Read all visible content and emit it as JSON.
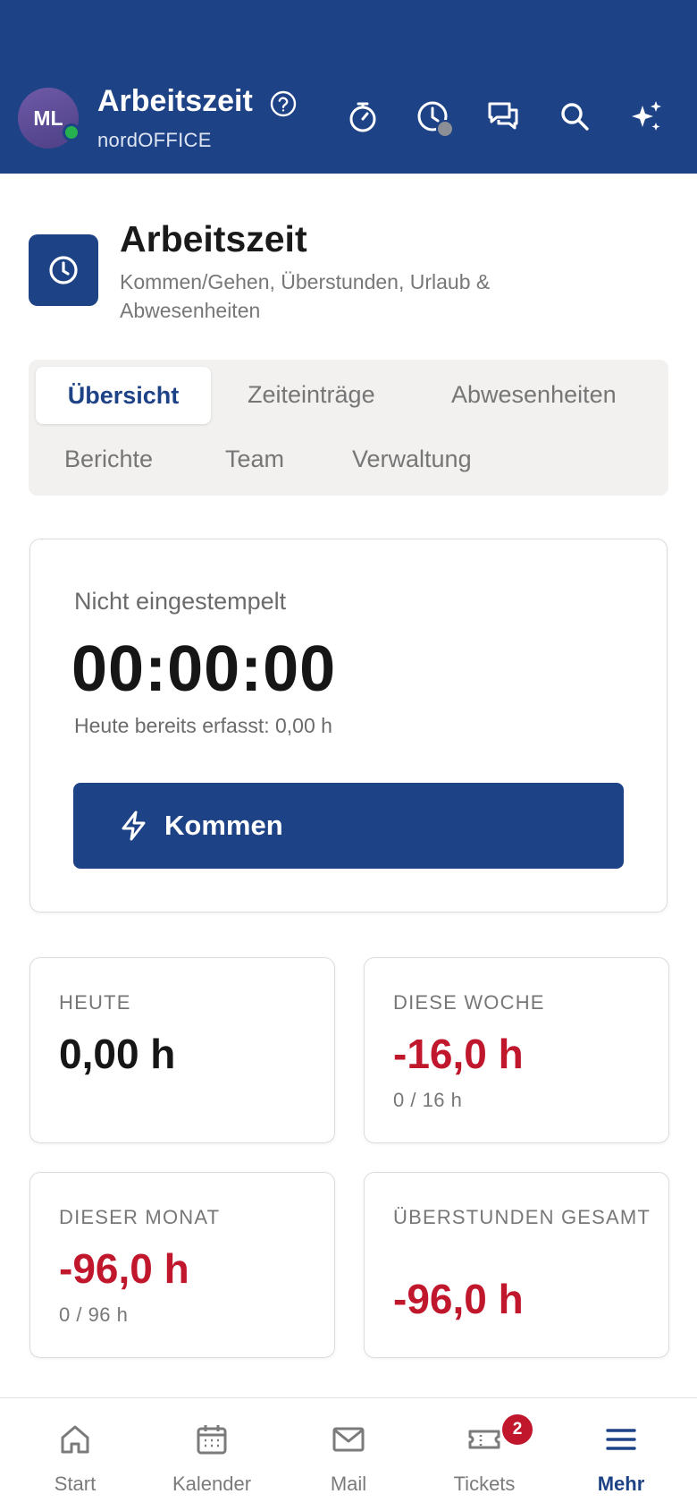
{
  "header": {
    "avatar_initials": "ML",
    "title": "Arbeitszeit",
    "subtitle": "nordOFFICE",
    "online_status_color": "#27b04f",
    "icons": [
      "help-icon",
      "stopwatch-icon",
      "clock-history-icon",
      "chat-icon",
      "search-icon",
      "sparkles-icon"
    ]
  },
  "module": {
    "icon": "clock-icon",
    "title": "Arbeitszeit",
    "description": "Kommen/Gehen, Überstunden, Urlaub & Abwesenheiten"
  },
  "tabs": [
    {
      "label": "Übersicht",
      "active": true
    },
    {
      "label": "Zeiteinträge",
      "active": false
    },
    {
      "label": "Abwesenheiten",
      "active": false
    },
    {
      "label": "Berichte",
      "active": false
    },
    {
      "label": "Team",
      "active": false
    },
    {
      "label": "Verwaltung",
      "active": false
    }
  ],
  "clock": {
    "status": "Nicht eingestempelt",
    "timer": "00:00:00",
    "today_recorded": "Heute bereits erfasst: 0,00 h",
    "button_label": "Kommen",
    "button_icon": "lightning-icon"
  },
  "stats": [
    {
      "label": "HEUTE",
      "value": "0,00 h",
      "sub": ""
    },
    {
      "label": "DIESE WOCHE",
      "value": "-16,0 h",
      "sub": "0 / 16 h"
    },
    {
      "label": "DIESER MONAT",
      "value": "-96,0 h",
      "sub": "0 / 96 h"
    },
    {
      "label": "ÜBERSTUNDEN GESAMT",
      "value": "-96,0 h",
      "sub": ""
    }
  ],
  "nav": [
    {
      "label": "Start",
      "icon": "home-icon"
    },
    {
      "label": "Kalender",
      "icon": "calendar-icon"
    },
    {
      "label": "Mail",
      "icon": "mail-icon"
    },
    {
      "label": "Tickets",
      "icon": "ticket-icon",
      "badge": "2"
    },
    {
      "label": "Mehr",
      "icon": "menu-icon",
      "active": true
    }
  ],
  "colors": {
    "brand": "#1e4286",
    "negative": "#c0172c",
    "background": "#ffffff"
  }
}
